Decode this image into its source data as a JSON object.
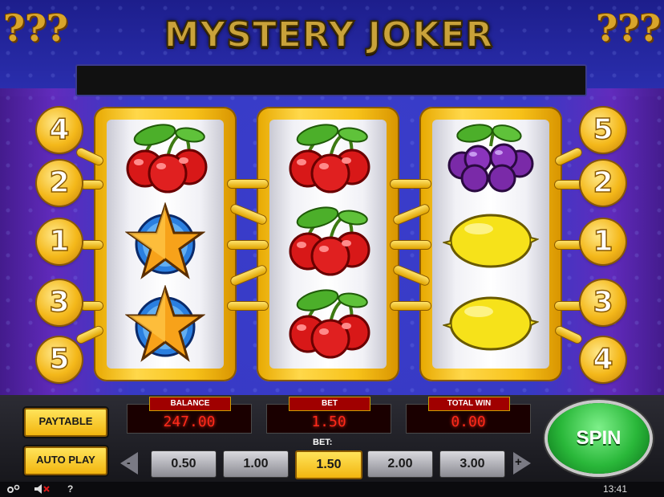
{
  "title": "MYSTERY JOKER",
  "decoration": {
    "corner_glyph": "???"
  },
  "message_bar": "",
  "reels": [
    {
      "symbols": [
        "cherry",
        "star",
        "star"
      ]
    },
    {
      "symbols": [
        "cherry",
        "cherry",
        "cherry"
      ]
    },
    {
      "symbols": [
        "plum",
        "lemon",
        "lemon"
      ]
    }
  ],
  "paylines": {
    "left": [
      "4",
      "2",
      "1",
      "3",
      "5"
    ],
    "right": [
      "5",
      "2",
      "1",
      "3",
      "4"
    ]
  },
  "buttons": {
    "paytable": "PAYTABLE",
    "autoplay": "AUTO PLAY",
    "spin": "SPIN"
  },
  "displays": {
    "balance": {
      "label": "BALANCE",
      "value": "247.00"
    },
    "bet": {
      "label": "BET",
      "value": "1.50"
    },
    "total_win": {
      "label": "TOTAL WIN",
      "value": "0.00"
    }
  },
  "bet_selector": {
    "label": "BET:",
    "decrease": "-",
    "increase": "+",
    "options": [
      "0.50",
      "1.00",
      "1.50",
      "2.00",
      "3.00"
    ],
    "selected": "1.50"
  },
  "status": {
    "help": "?",
    "time": "13:41"
  },
  "colors": {
    "accent_gold": "#f2b50f",
    "spin_green": "#2ab83a",
    "display_red": "#ff2a1a"
  }
}
